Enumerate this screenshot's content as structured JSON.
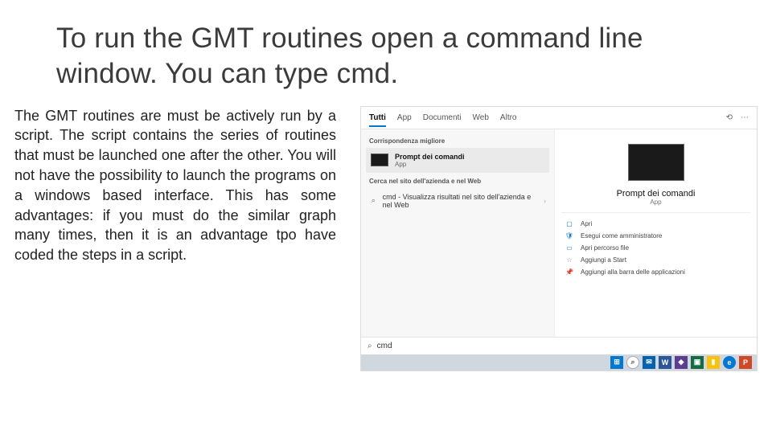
{
  "title": "To run the GMT routines open a command line window. You can type cmd.",
  "body": "The GMT routines are must be actively run by a script. The script contains the series of routines that must be launched one after the other. You will not have the possibility to launch the programs on a windows based interface. This has some advantages: if you must do the similar graph many times, then it is an advantage tpo have coded the steps in a script.",
  "search": {
    "tabs": [
      "Tutti",
      "App",
      "Documenti",
      "Web",
      "Altro"
    ],
    "section_best": "Corrispondenza migliore",
    "best_title": "Prompt dei comandi",
    "best_sub": "App",
    "section_web": "Cerca nel sito dell'azienda e nel Web",
    "web_result": "cmd - Visualizza risultati nel sito dell'azienda e nel Web",
    "app_title": "Prompt dei comandi",
    "app_sub": "App",
    "actions": [
      "Apri",
      "Esegui come amministratore",
      "Apri percorso file",
      "Aggiungi a Start",
      "Aggiungi alla barra delle applicazioni"
    ],
    "input_value": "cmd"
  }
}
